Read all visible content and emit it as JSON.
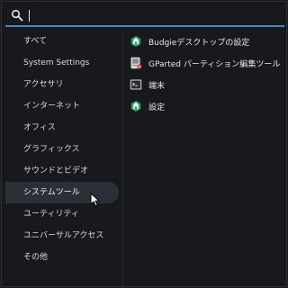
{
  "search": {
    "value": "",
    "placeholder": ""
  },
  "categories": [
    {
      "label": "すべて",
      "active": false
    },
    {
      "label": "System Settings",
      "active": false
    },
    {
      "label": "アクセサリ",
      "active": false
    },
    {
      "label": "インターネット",
      "active": false
    },
    {
      "label": "オフィス",
      "active": false
    },
    {
      "label": "グラフィックス",
      "active": false
    },
    {
      "label": "サウンドとビデオ",
      "active": false
    },
    {
      "label": "システムツール",
      "active": true
    },
    {
      "label": "ユーティリティ",
      "active": false
    },
    {
      "label": "ユニバーサルアクセス",
      "active": false
    },
    {
      "label": "その他",
      "active": false
    }
  ],
  "apps": [
    {
      "label": "Budgieデスクトップの設定",
      "icon": "budgie-settings-icon"
    },
    {
      "label": "GParted パーティション編集ツール",
      "icon": "gparted-icon"
    },
    {
      "label": "端末",
      "icon": "terminal-icon"
    },
    {
      "label": "設定",
      "icon": "settings-icon"
    }
  ],
  "colors": {
    "accent": "#4e82c4",
    "background": "#17191c",
    "active_row": "#2b3038",
    "brand_green": "#2fa36b"
  }
}
